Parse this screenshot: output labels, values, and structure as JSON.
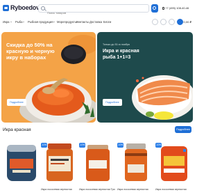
{
  "header": {
    "logo": "Ryboedov",
    "search_placeholder": "Поиск товаров",
    "phone": "+7 (495) 108-40-46"
  },
  "nav": {
    "items": [
      {
        "label": "Икра",
        "has_menu": true
      },
      {
        "label": "Рыба",
        "has_menu": true
      },
      {
        "label": "Рыбная продукция",
        "has_menu": true
      },
      {
        "label": "Морепродукты",
        "has_menu": true
      },
      {
        "label": "Контакты",
        "has_menu": false
      },
      {
        "label": "Доставка",
        "has_menu": false
      },
      {
        "label": "Блоги",
        "has_menu": false
      }
    ],
    "cart_total": "0,00 ₽"
  },
  "banners": [
    {
      "title_lines": [
        "Скидка до 50% на",
        "красную и черную",
        "икру в наборах"
      ],
      "button": "Подробнее",
      "color": "#f4a347"
    },
    {
      "small": "Только до 30-го ноября",
      "title_lines": [
        "Икра и красная",
        "рыба 1+1=3"
      ],
      "button": "Подробнее",
      "color": "#1e4a4c"
    }
  ],
  "section": {
    "title": "Икра красная",
    "button": "Подробнее"
  },
  "products": [
    {
      "name": "",
      "badge": ""
    },
    {
      "name": "Икра лососевая зернистая",
      "badge": "-10%"
    },
    {
      "name": "Икра лососевая зернистая Три",
      "badge": "-10%"
    },
    {
      "name": "Икра лососевая зернистая",
      "badge": "-10%"
    },
    {
      "name": "Икра лососевая зернистая",
      "badge": "-10%"
    }
  ],
  "colors": {
    "accent": "#1f6fd6",
    "orange": "#f4a347",
    "teal": "#1e4a4c",
    "badge": "#2e80e8"
  }
}
